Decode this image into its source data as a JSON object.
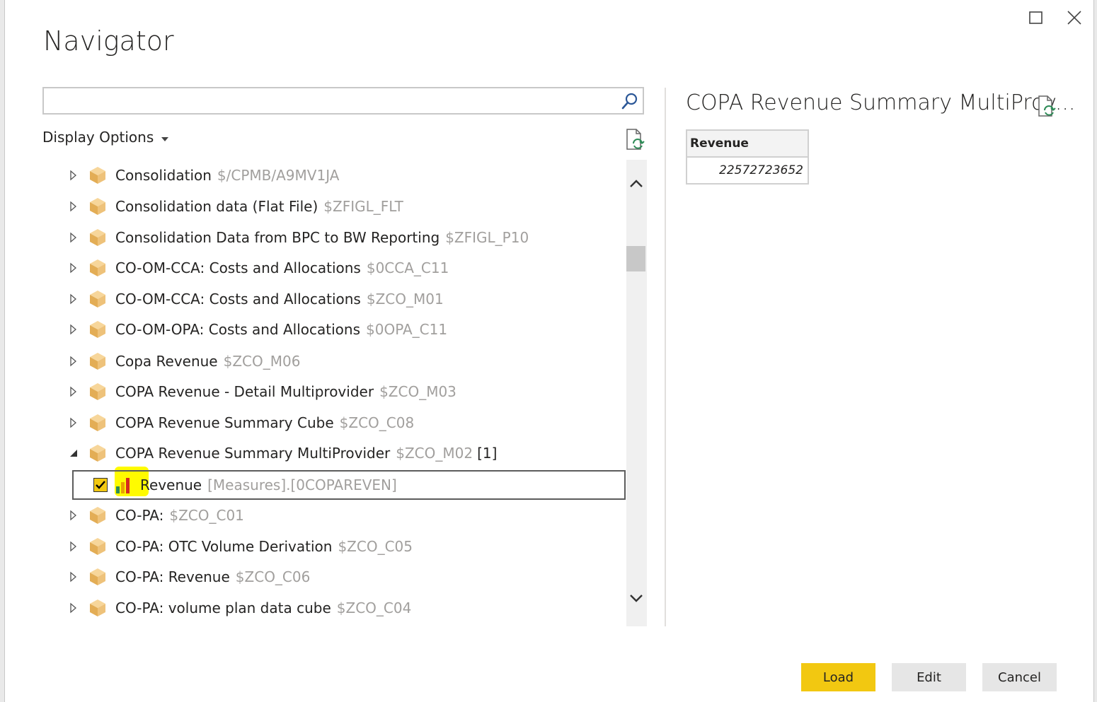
{
  "dialog": {
    "title": "Navigator"
  },
  "search": {
    "value": "",
    "placeholder": ""
  },
  "display_options": {
    "label": "Display Options"
  },
  "tree": {
    "items": [
      {
        "name": "Consolidation",
        "code": "$/CPMB/A9MV1JA",
        "expanded": false
      },
      {
        "name": "Consolidation data (Flat File)",
        "code": "$ZFIGL_FLT",
        "expanded": false
      },
      {
        "name": "Consolidation Data from BPC to BW Reporting",
        "code": "$ZFIGL_P10",
        "expanded": false
      },
      {
        "name": "CO-OM-CCA: Costs and Allocations",
        "code": "$0CCA_C11",
        "expanded": false
      },
      {
        "name": "CO-OM-CCA: Costs and Allocations",
        "code": "$ZCO_M01",
        "expanded": false
      },
      {
        "name": "CO-OM-OPA: Costs and Allocations",
        "code": "$0OPA_C11",
        "expanded": false
      },
      {
        "name": "Copa Revenue",
        "code": "$ZCO_M06",
        "expanded": false
      },
      {
        "name": "COPA Revenue - Detail Multiprovider",
        "code": "$ZCO_M03",
        "expanded": false
      },
      {
        "name": "COPA Revenue Summary Cube",
        "code": "$ZCO_C08",
        "expanded": false
      },
      {
        "name": "COPA Revenue Summary MultiProvider",
        "code": "$ZCO_M02",
        "count": "[1]",
        "expanded": true
      },
      {
        "name": "CO-PA:",
        "code": "$ZCO_C01",
        "expanded": false
      },
      {
        "name": "CO-PA: OTC Volume Derivation",
        "code": "$ZCO_C05",
        "expanded": false
      },
      {
        "name": "CO-PA: Revenue",
        "code": "$ZCO_C06",
        "expanded": false
      },
      {
        "name": "CO-PA: volume plan data cube",
        "code": "$ZCO_C04",
        "expanded": false
      }
    ],
    "child": {
      "name": "Revenue",
      "code": "[Measures].[0COPAREVEN]",
      "checked": true
    }
  },
  "preview": {
    "title": "COPA Revenue Summary MultiProv...",
    "column_header": "Revenue",
    "value": "22572723652"
  },
  "buttons": {
    "load": "Load",
    "edit": "Edit",
    "cancel": "Cancel"
  },
  "colors": {
    "accent": "#f2c811",
    "cube": "#e8b866",
    "highlight": "#fffb00",
    "muted_text": "#a19f9d"
  },
  "icons": {
    "search": "search-icon",
    "refresh": "refresh-icon",
    "cube": "cube-icon",
    "measure": "bar-chart-icon",
    "maximize": "maximize-icon",
    "close": "close-icon"
  }
}
